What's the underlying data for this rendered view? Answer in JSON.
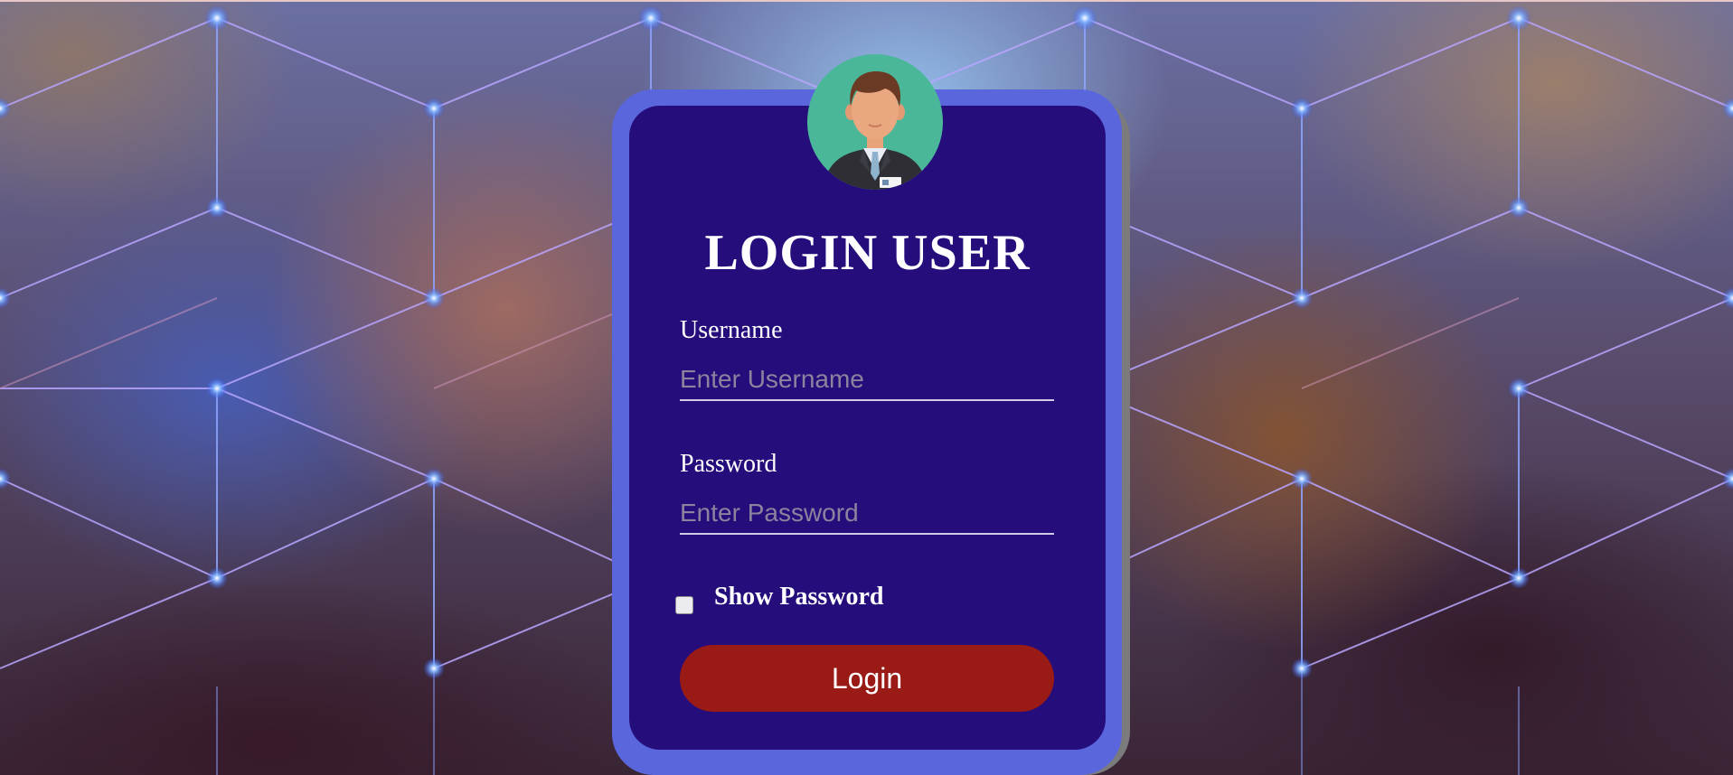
{
  "login": {
    "title": "LOGIN USER",
    "username_label": "Username",
    "username_placeholder": "Enter Username",
    "username_value": "",
    "password_label": "Password",
    "password_placeholder": "Enter Password",
    "password_value": "",
    "show_password_label": "Show Password",
    "show_password_checked": false,
    "login_button": "Login"
  },
  "icons": {
    "avatar": "user-avatar-icon"
  },
  "colors": {
    "card_border": "#5a67dc",
    "card_background": "#240978",
    "login_button": "#9a1a16",
    "avatar_background": "#4bb799",
    "text": "#ffffff"
  }
}
